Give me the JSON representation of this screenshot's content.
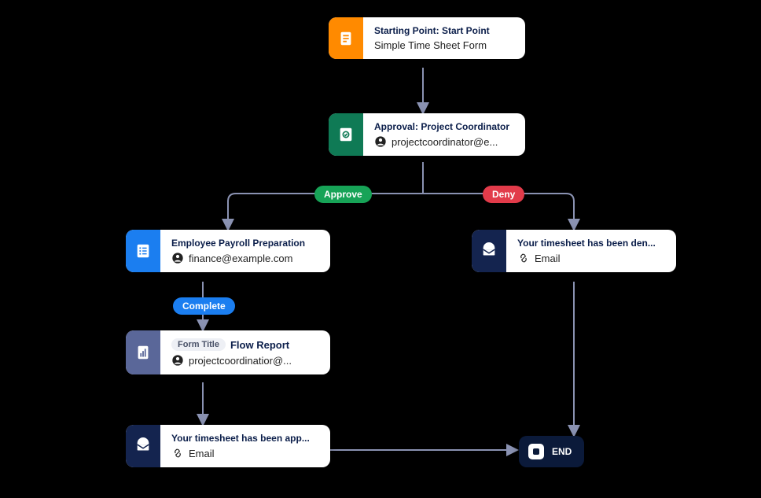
{
  "nodes": {
    "start": {
      "title": "Starting Point: Start Point",
      "subtitle": "Simple Time Sheet Form",
      "icon": "document-icon",
      "accent": "#ff8a00"
    },
    "approval": {
      "title": "Approval: Project Coordinator",
      "subtitle": "projectcoordinator@e...",
      "icon": "approval-icon",
      "accent": "#0f7a55"
    },
    "payroll": {
      "title": "Employee Payroll Preparation",
      "subtitle": "finance@example.com",
      "icon": "task-list-icon",
      "accent": "#1b7ef0"
    },
    "denied": {
      "title": "Your timesheet has been den...",
      "subtitle": "Email",
      "icon": "mail-icon",
      "accent": "#14244f"
    },
    "report": {
      "chip": "Form Title",
      "title": "Flow Report",
      "subtitle": "projectcoordinatior@...",
      "icon": "report-icon",
      "accent": "#5a6799"
    },
    "approved": {
      "title": "Your timesheet has been app...",
      "subtitle": "Email",
      "icon": "mail-icon",
      "accent": "#14244f"
    },
    "end": {
      "label": "END"
    }
  },
  "pills": {
    "approve": {
      "label": "Approve",
      "color": "#17a357"
    },
    "deny": {
      "label": "Deny",
      "color": "#e23b4a"
    },
    "complete": {
      "label": "Complete",
      "color": "#1b7ef0"
    }
  }
}
